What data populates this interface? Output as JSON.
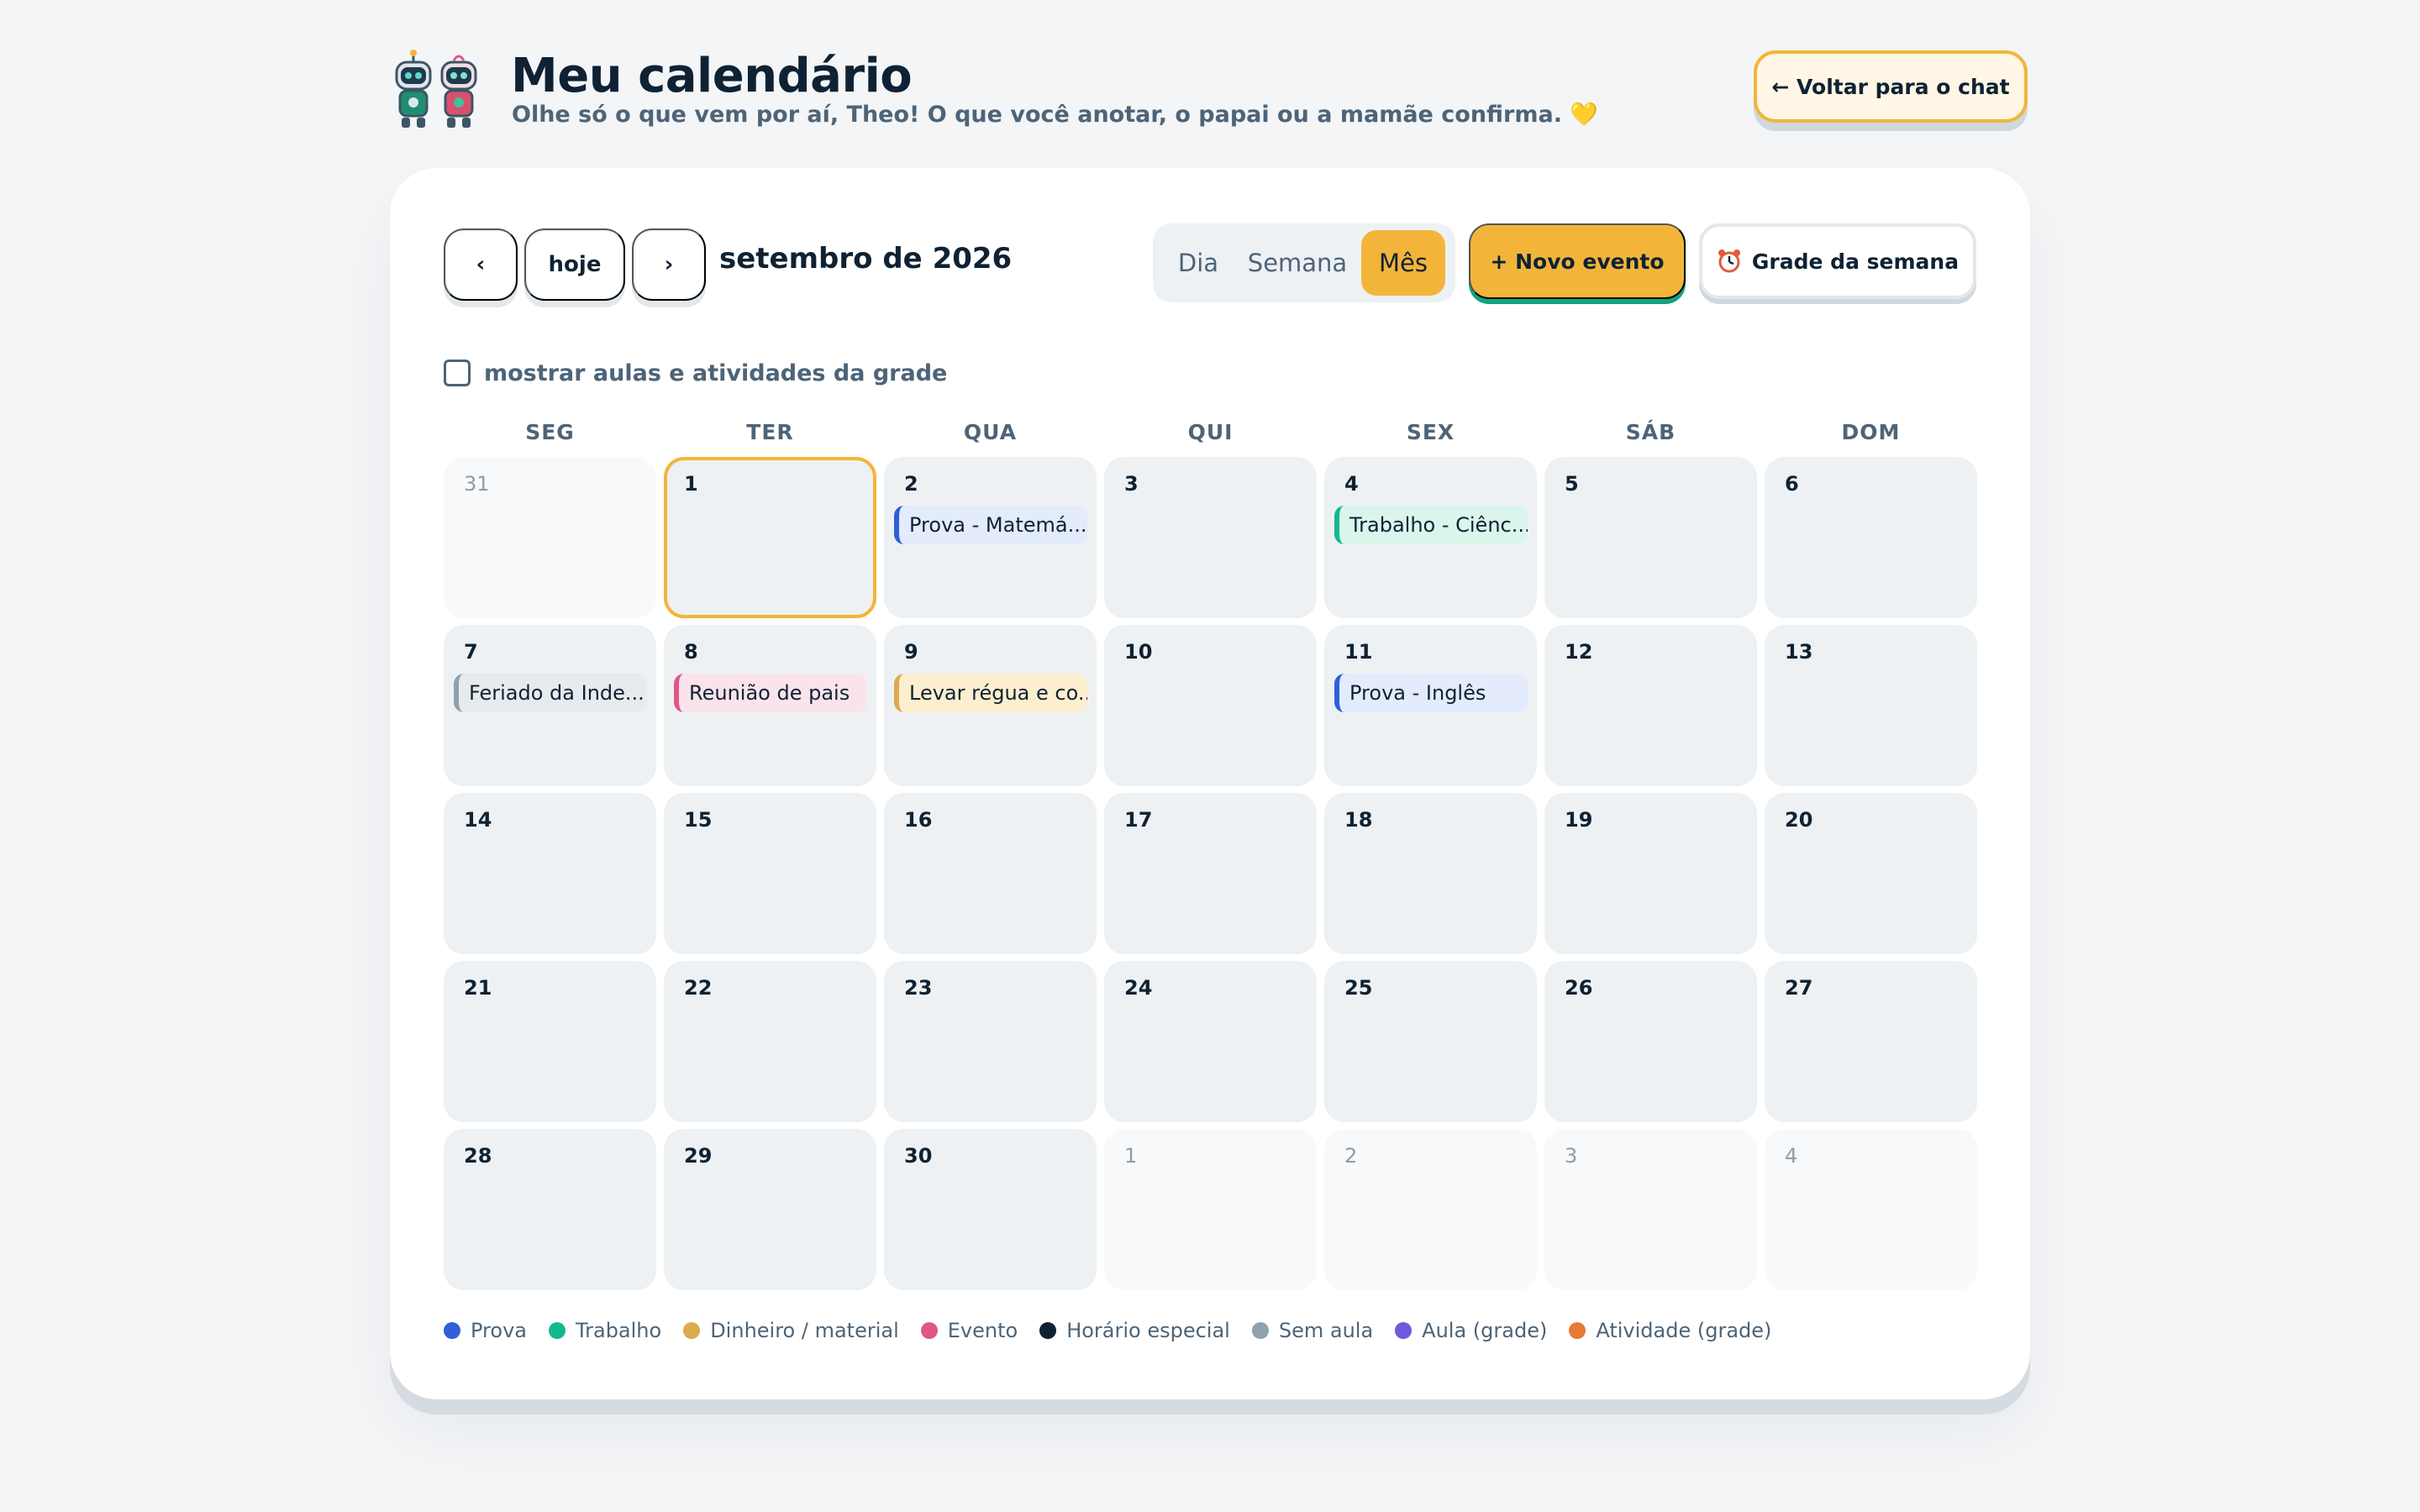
{
  "header": {
    "title": "Meu calendário",
    "subtitle": "Olhe só o que vem por aí, Theo! O que você anotar, o papai ou a mamãe confirma. 💛",
    "back_label": "← Voltar para o chat"
  },
  "toolbar": {
    "prev_label": "‹",
    "today_label": "hoje",
    "next_label": "›",
    "month_label": "setembro de 2026",
    "views": [
      "Dia",
      "Semana",
      "Mês"
    ],
    "active_view": "Mês",
    "new_event_label": "+ Novo evento",
    "week_grid_label": "Grade da semana"
  },
  "grid_toggle": {
    "label": "mostrar aulas e atividades da grade",
    "checked": false
  },
  "weekdays": [
    "SEG",
    "TER",
    "QUA",
    "QUI",
    "SEX",
    "SÁB",
    "DOM"
  ],
  "weeks": [
    [
      {
        "num": "31",
        "outside": true
      },
      {
        "num": "1",
        "today": true
      },
      {
        "num": "2",
        "event": {
          "label": "Prova - Matemá...",
          "category": "prova"
        }
      },
      {
        "num": "3"
      },
      {
        "num": "4",
        "event": {
          "label": "Trabalho - Ciênc...",
          "category": "trabalho"
        }
      },
      {
        "num": "5"
      },
      {
        "num": "6"
      }
    ],
    [
      {
        "num": "7",
        "event": {
          "label": "Feriado da Inde...",
          "category": "sem_aula"
        }
      },
      {
        "num": "8",
        "event": {
          "label": "Reunião de pais",
          "category": "evento"
        }
      },
      {
        "num": "9",
        "event": {
          "label": "Levar régua e co...",
          "category": "dinheiro"
        }
      },
      {
        "num": "10"
      },
      {
        "num": "11",
        "event": {
          "label": "Prova - Inglês",
          "category": "prova"
        }
      },
      {
        "num": "12"
      },
      {
        "num": "13"
      }
    ],
    [
      {
        "num": "14"
      },
      {
        "num": "15"
      },
      {
        "num": "16"
      },
      {
        "num": "17"
      },
      {
        "num": "18"
      },
      {
        "num": "19"
      },
      {
        "num": "20"
      }
    ],
    [
      {
        "num": "21"
      },
      {
        "num": "22"
      },
      {
        "num": "23"
      },
      {
        "num": "24"
      },
      {
        "num": "25"
      },
      {
        "num": "26"
      },
      {
        "num": "27"
      }
    ],
    [
      {
        "num": "28"
      },
      {
        "num": "29"
      },
      {
        "num": "30"
      },
      {
        "num": "1",
        "outside": true
      },
      {
        "num": "2",
        "outside": true
      },
      {
        "num": "3",
        "outside": true
      },
      {
        "num": "4",
        "outside": true
      }
    ]
  ],
  "categories": {
    "prova": {
      "border": "#2f5fd7",
      "bg": "#e3ebfc"
    },
    "trabalho": {
      "border": "#14b88f",
      "bg": "#daf5ec"
    },
    "dinheiro": {
      "border": "#dcaa4f",
      "bg": "#fcefcf"
    },
    "evento": {
      "border": "#e0568a",
      "bg": "#fbe3ec"
    },
    "sem_aula": {
      "border": "#8fa1ad",
      "bg": "#e6ebee"
    }
  },
  "legend": [
    {
      "label": "Prova",
      "color": "#2f5fd7"
    },
    {
      "label": "Trabalho",
      "color": "#14b88f"
    },
    {
      "label": "Dinheiro / material",
      "color": "#dcaa4f"
    },
    {
      "label": "Evento",
      "color": "#e0568a"
    },
    {
      "label": "Horário especial",
      "color": "#0f2233"
    },
    {
      "label": "Sem aula",
      "color": "#8fa1ad"
    },
    {
      "label": "Aula (grade)",
      "color": "#7158dc"
    },
    {
      "label": "Atividade (grade)",
      "color": "#e57a35"
    }
  ],
  "colors": {
    "accent": "#f2b53a",
    "accent_shadow": "#14a37f",
    "text": "#0f2233",
    "muted": "#4d6478"
  },
  "icons": {
    "logo": "robots-icon",
    "week_grid": "alarm-clock-icon"
  }
}
